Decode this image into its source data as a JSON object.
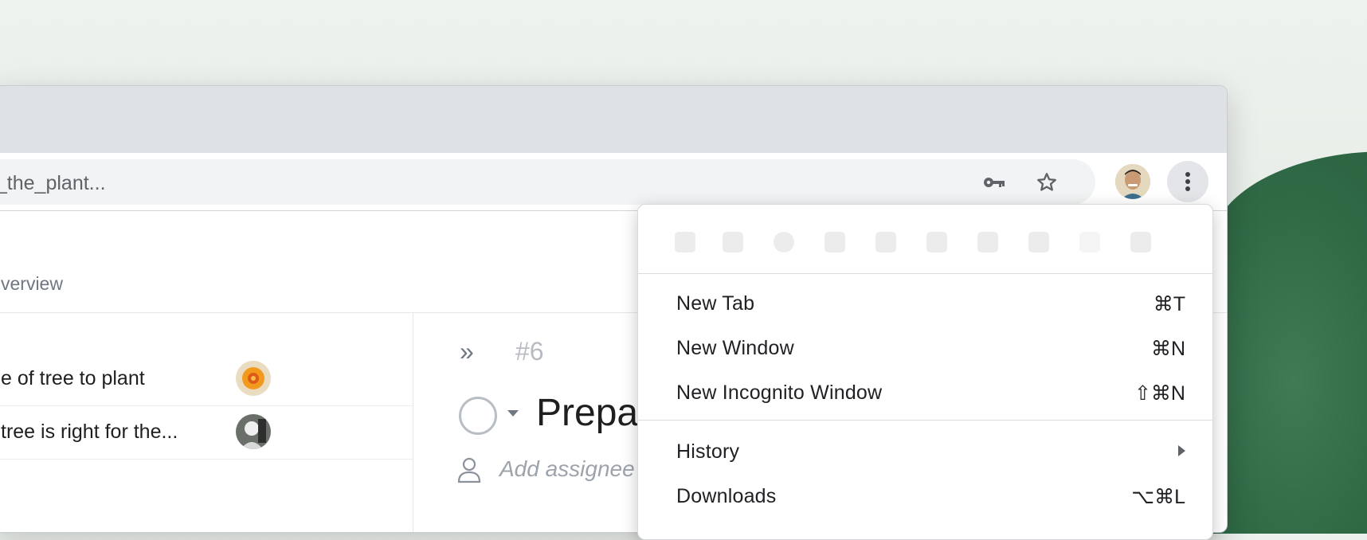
{
  "browser": {
    "address_text": "e_the_plant...",
    "buttons": {
      "key": "key-icon",
      "star": "star-icon",
      "profile": "avatar",
      "menu": "three-dot-menu-icon"
    }
  },
  "page": {
    "tab_label": "verview",
    "tasks": [
      {
        "name": "e of tree to plant"
      },
      {
        "name": "tree is right for the..."
      }
    ],
    "detail": {
      "task_number": "#6",
      "title": "Prepa",
      "assignee_placeholder": "Add assignee"
    }
  },
  "menu": {
    "items": [
      {
        "label": "New Tab",
        "shortcut": "⌘T"
      },
      {
        "label": "New Window",
        "shortcut": "⌘N"
      },
      {
        "label": "New Incognito Window",
        "shortcut": "⇧⌘N"
      },
      {
        "label": "History",
        "shortcut": ""
      },
      {
        "label": "Downloads",
        "shortcut": "⌥⌘L"
      }
    ]
  },
  "colors": {
    "tabstrip": "#dee1e6",
    "omnibox": "#f1f3f4",
    "wallpaper_green": "#2f6a45"
  }
}
